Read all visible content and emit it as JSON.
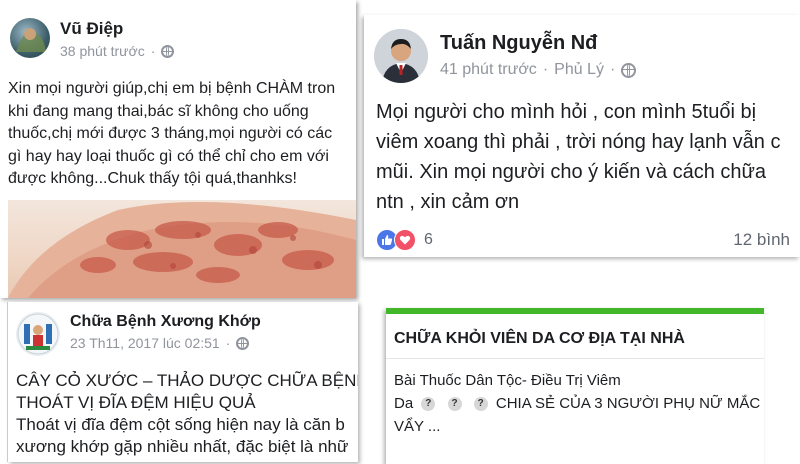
{
  "post1": {
    "author": "Vũ Điệp",
    "time": "38 phút trước",
    "text_lines": [
      "Xin mọi người giúp,chị em bị bệnh CHÀM tron",
      "khi đang mang thai,bác sĩ không cho uống",
      "thuốc,chị mới được 3 tháng,mọi người có các",
      "gì hay hay loại thuốc gì có thể chỉ cho em với",
      "được không...Chuk thấy tội quá,thanhks!"
    ],
    "globe_icon": "globe-icon"
  },
  "post2": {
    "author": "Tuấn Nguyễn Nđ",
    "time": "41 phút trước",
    "location": "Phủ Lý",
    "text_lines": [
      "Mọi người cho mình hỏi , con mình 5tuổi bị",
      "viêm xoang thì phải , trời nóng hay lạnh vẫn c",
      "mũi. Xin mọi người cho ý kiến và cách chữa",
      "ntn , xin cảm ơn"
    ],
    "reactions_count": "6",
    "comments": "12 bình"
  },
  "post3": {
    "author": "Chữa Bệnh Xương Khớp",
    "time": "23 Th11, 2017 lúc 02:51",
    "text_lines": [
      "CÂY CỎ XƯỚC – THẢO DƯỢC CHỮA BỆNH",
      "THOÁT VỊ ĐĨA ĐỆM HIỆU QUẢ",
      "Thoát vị đĩa đệm cột sống hiện nay là căn b",
      "xương khớp gặp nhiều nhất, đặc biệt là nhữ"
    ]
  },
  "post4": {
    "title": "CHỮA KHỎI VIÊN DA CƠ ĐỊA TẠI NHÀ",
    "line1": "Bài Thuốc Dân Tộc- Điều Trị Viêm",
    "line2_prefix": "Da",
    "line2_suffix": "CHIA SẺ CỦA 3 NGƯỜI PHỤ NỮ MẮC",
    "line3": "VẨY ...",
    "qmark": "?",
    "accent": "#42b72a"
  },
  "colors": {
    "link_blue": "#4267b2",
    "meta_gray": "#90949c",
    "like_blue": "#4a76e8",
    "love_red": "#f25268"
  }
}
